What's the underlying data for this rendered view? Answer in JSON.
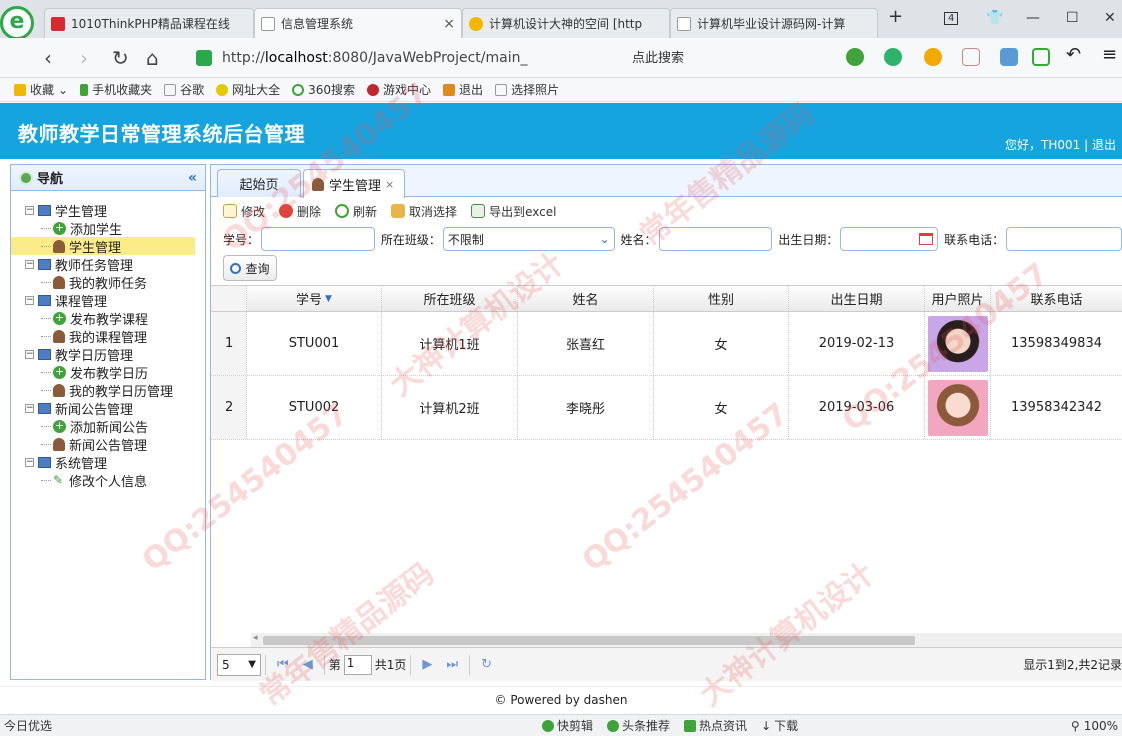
{
  "browser": {
    "tabs": [
      {
        "label": "1010ThinkPHP精品课程在线"
      },
      {
        "label": "信息管理系统"
      },
      {
        "label": "计算机设计大神的空间 [http"
      },
      {
        "label": "计算机毕业设计源码网-计算"
      }
    ],
    "tab_count": "4",
    "url_prefix": "http://",
    "url_host": "localhost",
    "url_rest": ":8080/JavaWebProject/main_",
    "search_placeholder": "点此搜索",
    "bookmarks": [
      "收藏",
      "手机收藏夹",
      "谷歌",
      "网址大全",
      "360搜索",
      "游戏中心",
      "退出",
      "选择照片"
    ]
  },
  "app": {
    "title": "教师教学日常管理系统后台管理",
    "greeting": "您好，TH001",
    "separator": "|",
    "logout": "退出"
  },
  "sidebar": {
    "title": "导航",
    "groups": [
      {
        "label": "学生管理",
        "items": [
          "添加学生",
          "学生管理"
        ]
      },
      {
        "label": "教师任务管理",
        "items": [
          "我的教师任务"
        ]
      },
      {
        "label": "课程管理",
        "items": [
          "发布教学课程",
          "我的课程管理"
        ]
      },
      {
        "label": "教学日历管理",
        "items": [
          "发布教学日历",
          "我的教学日历管理"
        ]
      },
      {
        "label": "新闻公告管理",
        "items": [
          "添加新闻公告",
          "新闻公告管理"
        ]
      },
      {
        "label": "系统管理",
        "items": [
          "修改个人信息"
        ]
      }
    ]
  },
  "main": {
    "tabs": [
      {
        "label": "起始页"
      },
      {
        "label": "学生管理",
        "close": "×"
      }
    ],
    "toolbar": [
      "修改",
      "删除",
      "刷新",
      "取消选择",
      "导出到excel"
    ],
    "search": {
      "student_no_label": "学号：",
      "class_label": "所在班级：",
      "class_value": "不限制",
      "name_label": "姓名：",
      "birth_label": "出生日期：",
      "phone_label": "联系电话：",
      "query_button": "查询"
    },
    "grid": {
      "columns": [
        "学号",
        "所在班级",
        "姓名",
        "性别",
        "出生日期",
        "用户照片",
        "联系电话"
      ],
      "rows": [
        {
          "n": "1",
          "no": "STU001",
          "cls": "计算机1班",
          "name": "张喜红",
          "sex": "女",
          "birth": "2019-02-13",
          "phone": "13598349834"
        },
        {
          "n": "2",
          "no": "STU002",
          "cls": "计算机2班",
          "name": "李晓彤",
          "sex": "女",
          "birth": "2019-03-06",
          "phone": "13958342342"
        }
      ]
    },
    "pager": {
      "page_size": "5",
      "page_prefix": "第",
      "page_value": "1",
      "page_suffix": "共1页",
      "info": "显示1到2,共2记录"
    }
  },
  "footer": "© Powered by dashen",
  "statusbar": {
    "left": "今日优选",
    "items": [
      "快剪辑",
      "头条推荐",
      "热点资讯",
      "下载"
    ],
    "zoom": "100%"
  },
  "watermarks": [
    "QQ:254540457",
    "大神计算机设计",
    "常年售精品源码"
  ],
  "colors": {
    "header_bg": "#16a4e0",
    "panel_border": "#95b8e7",
    "selected_row": "#fbec88"
  }
}
